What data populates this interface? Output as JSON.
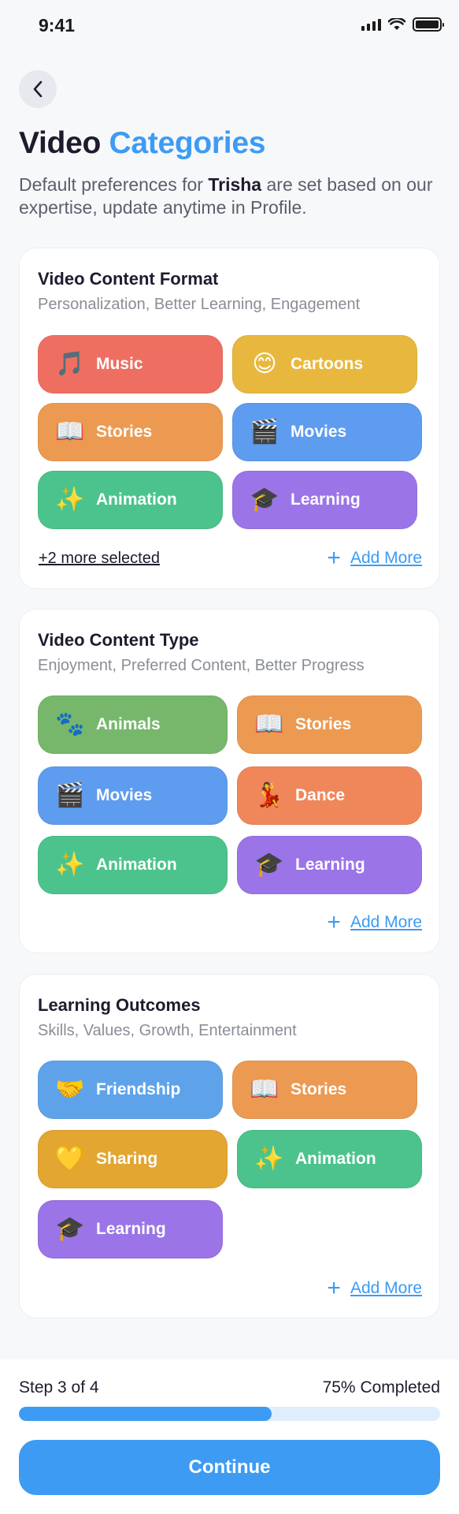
{
  "status_bar": {
    "time": "9:41"
  },
  "header": {
    "title_main": "Video",
    "title_accent": "Categories",
    "subtitle_pre": "Default preferences for",
    "subtitle_name": "Trisha",
    "subtitle_post": "are set based on our expertise, update anytime in Profile."
  },
  "sections": [
    {
      "title": "Video Content Format",
      "subtitle": "Personalization, Better Learning, Engagement",
      "chips": [
        {
          "label": "Music",
          "icon": "🎵",
          "icon_name": "music-icon",
          "color": "#ee6f61"
        },
        {
          "label": "Cartoons",
          "icon": "😊",
          "icon_name": "smiley-icon",
          "color": "#e8b83e"
        },
        {
          "label": "Stories",
          "icon": "📖",
          "icon_name": "book-icon",
          "color": "#ec9a52"
        },
        {
          "label": "Movies",
          "icon": "🎬",
          "icon_name": "clapper-icon",
          "color": "#5e9cef"
        },
        {
          "label": "Animation",
          "icon": "✨",
          "icon_name": "sparkles-icon",
          "color": "#4cc38c"
        },
        {
          "label": "Learning",
          "icon": "🎓",
          "icon_name": "graduation-cap-icon",
          "color": "#9b74e8"
        }
      ],
      "more_selected": "+2 more selected",
      "add_more": "Add More"
    },
    {
      "title": "Video Content Type",
      "subtitle": "Enjoyment, Preferred Content, Better Progress",
      "chips": [
        {
          "label": "Animals",
          "icon": "🐾",
          "icon_name": "paw-icon",
          "color": "#76b76c"
        },
        {
          "label": "Stories",
          "icon": "📖",
          "icon_name": "book-icon",
          "color": "#ec9a52"
        },
        {
          "label": "Movies",
          "icon": "🎬",
          "icon_name": "clapper-icon",
          "color": "#5e9cef"
        },
        {
          "label": "Dance",
          "icon": "💃",
          "icon_name": "dancer-icon",
          "color": "#f0875a"
        },
        {
          "label": "Animation",
          "icon": "✨",
          "icon_name": "sparkles-icon",
          "color": "#4cc38c"
        },
        {
          "label": "Learning",
          "icon": "🎓",
          "icon_name": "graduation-cap-icon",
          "color": "#9b74e8"
        }
      ],
      "add_more": "Add More"
    },
    {
      "title": "Learning Outcomes",
      "subtitle": "Skills, Values, Growth, Entertainment",
      "chips": [
        {
          "label": "Friendship",
          "icon": "🤝",
          "icon_name": "handshake-icon",
          "color": "#5ea3ea"
        },
        {
          "label": "Stories",
          "icon": "📖",
          "icon_name": "book-icon",
          "color": "#ec9a52"
        },
        {
          "label": "Sharing",
          "icon": "💛",
          "icon_name": "yellow-heart-icon",
          "color": "#e2a631"
        },
        {
          "label": "Animation",
          "icon": "✨",
          "icon_name": "sparkles-icon",
          "color": "#4cc38c"
        },
        {
          "label": "Learning",
          "icon": "🎓",
          "icon_name": "graduation-cap-icon",
          "color": "#9b74e8"
        }
      ],
      "add_more": "Add More"
    }
  ],
  "footer": {
    "step_label": "Step 3 of 4",
    "progress_label": "75% Completed",
    "progress_value": 0.6,
    "continue_label": "Continue"
  }
}
